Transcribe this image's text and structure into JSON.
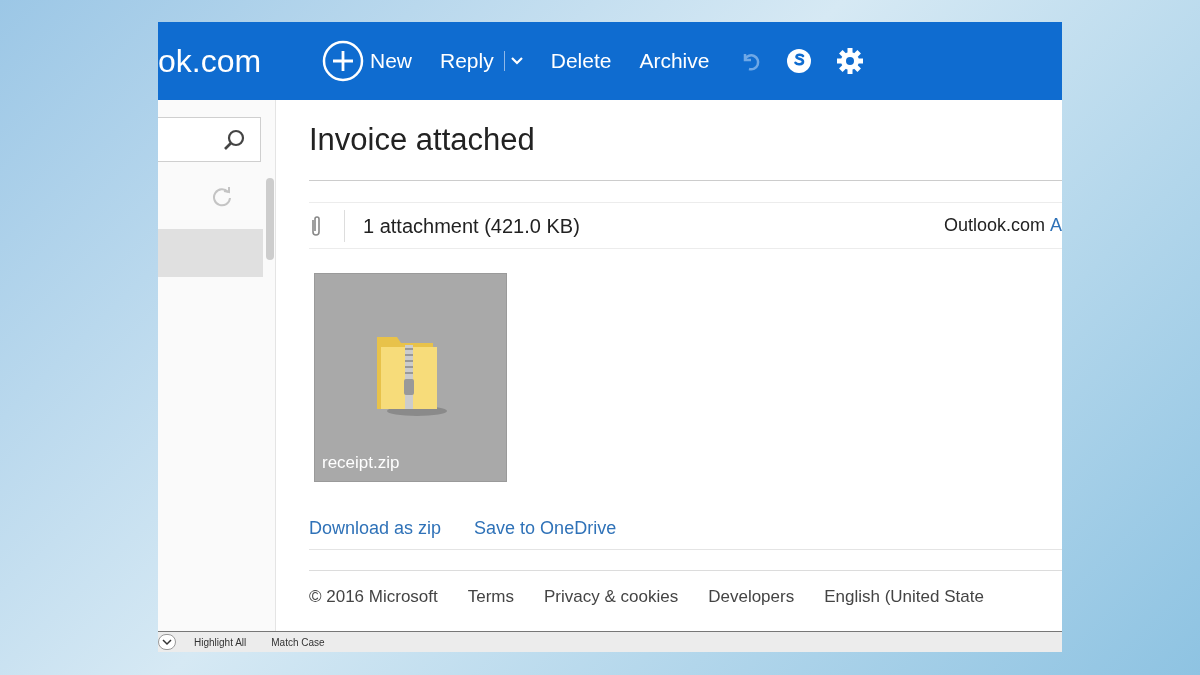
{
  "header": {
    "logo": "ok.com",
    "toolbar": [
      {
        "kind": "new",
        "label": "New"
      },
      {
        "kind": "split",
        "label": "Reply"
      },
      {
        "kind": "plain",
        "label": "Delete"
      },
      {
        "kind": "plain",
        "label": "Archive"
      }
    ]
  },
  "message": {
    "subject": "Invoice attached",
    "attachments_summary": "1 attachment (421.0 KB)",
    "source": "Outlook.com",
    "source_link": "A",
    "attachment": {
      "filename": "receipt.zip"
    },
    "actions": [
      "Download as zip",
      "Save to OneDrive"
    ]
  },
  "footer": [
    "© 2016 Microsoft",
    "Terms",
    "Privacy & cookies",
    "Developers",
    "English (United State"
  ],
  "find_bar": {
    "options": [
      "Highlight All",
      "Match Case"
    ]
  }
}
